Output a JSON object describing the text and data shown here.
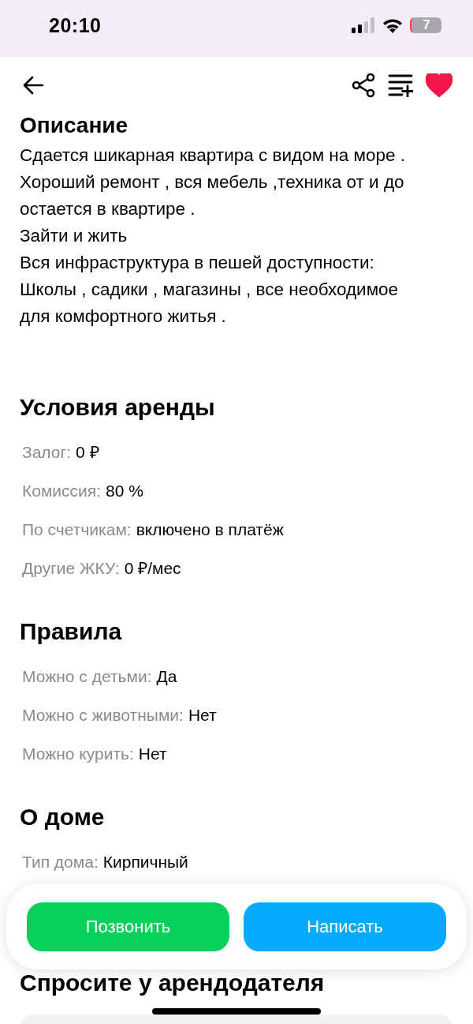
{
  "status_bar": {
    "time": "20:10",
    "battery": "7"
  },
  "header": {
    "favorited": true
  },
  "description": {
    "title": "Описание",
    "text": "Сдается шикарная квартира с видом на море .\nХороший ремонт , вся мебель ,техника от и до\nостается в квартире .\nЗайти и жить\nВся инфраструктура в пешей доступности:\nШколы , садики , магазины , все необходимое\nдля комфортного житья ."
  },
  "sections": [
    {
      "title": "Условия аренды",
      "items": [
        {
          "label": "Залог:",
          "value": "0 ₽"
        },
        {
          "label": "Комиссия:",
          "value": "80 %"
        },
        {
          "label": "По счетчикам:",
          "value": "включено в платёж"
        },
        {
          "label": "Другие ЖКУ:",
          "value": "0 ₽/мес"
        }
      ]
    },
    {
      "title": "Правила",
      "items": [
        {
          "label": "Можно с детьми:",
          "value": "Да"
        },
        {
          "label": "Можно с животными:",
          "value": "Нет"
        },
        {
          "label": "Можно курить:",
          "value": "Нет"
        }
      ]
    },
    {
      "title": "О доме",
      "items": [
        {
          "label": "Тип дома:",
          "value": "Кирпичный"
        }
      ]
    }
  ],
  "ask_section": {
    "title": "Спросите у арендодателя"
  },
  "actions": [
    {
      "label": "Позвонить",
      "color": "#05d05a"
    },
    {
      "label": "Написать",
      "color": "#03aafe"
    }
  ]
}
